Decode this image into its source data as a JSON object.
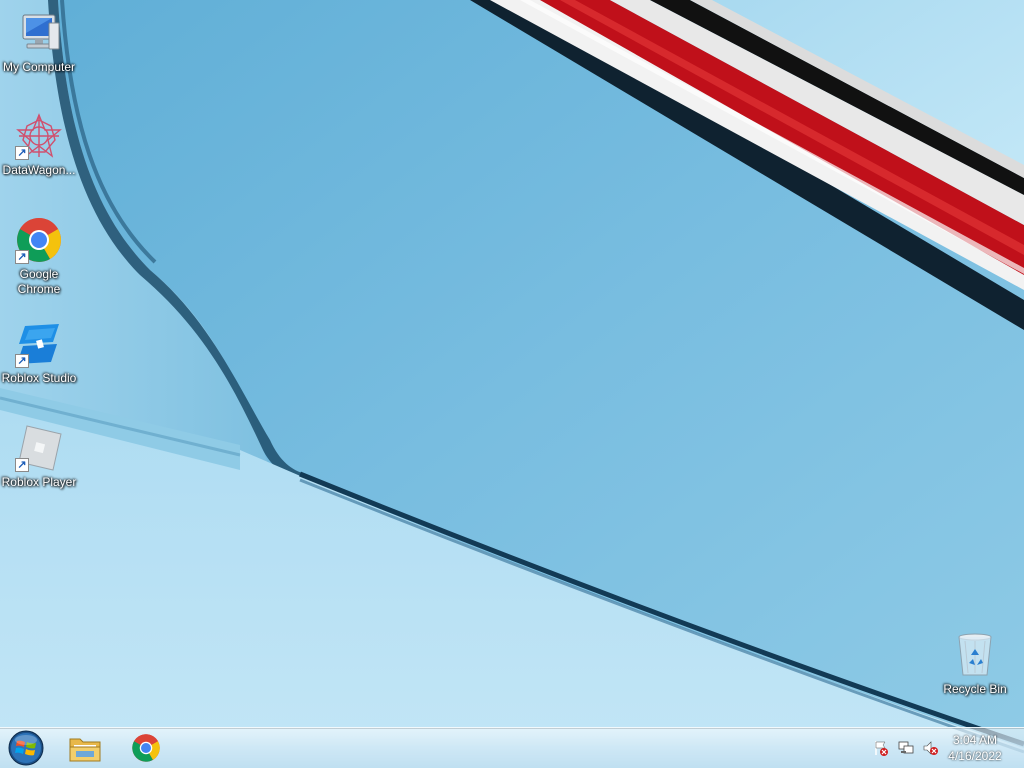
{
  "desktop_icons": [
    {
      "label": "My Computer",
      "icon": "computer-icon",
      "shortcut": false
    },
    {
      "label": "DataWagon...",
      "icon": "datawagon-icon",
      "shortcut": true
    },
    {
      "label": "Google Chrome",
      "icon": "chrome-icon",
      "shortcut": true
    },
    {
      "label": "Roblox Studio",
      "icon": "roblox-studio-icon",
      "shortcut": true
    },
    {
      "label": "Roblox Player",
      "icon": "roblox-player-icon",
      "shortcut": true
    },
    {
      "label": "Recycle Bin",
      "icon": "recycle-bin-icon",
      "shortcut": false
    }
  ],
  "taskbar": {
    "start_icon": "windows-start-orb-icon",
    "pinned": [
      {
        "name": "file-explorer",
        "icon": "folder-icon"
      },
      {
        "name": "google-chrome",
        "icon": "chrome-icon"
      }
    ],
    "tray": {
      "icons": [
        "action-center-flag-icon",
        "network-icon",
        "volume-muted-icon"
      ],
      "time": "3:04 AM",
      "date": "4/16/2022"
    }
  },
  "colors": {
    "wallpaper_main": "#7dbfe0",
    "wallpaper_light": "#b9e1f4",
    "stripe_red": "#c0101a"
  }
}
